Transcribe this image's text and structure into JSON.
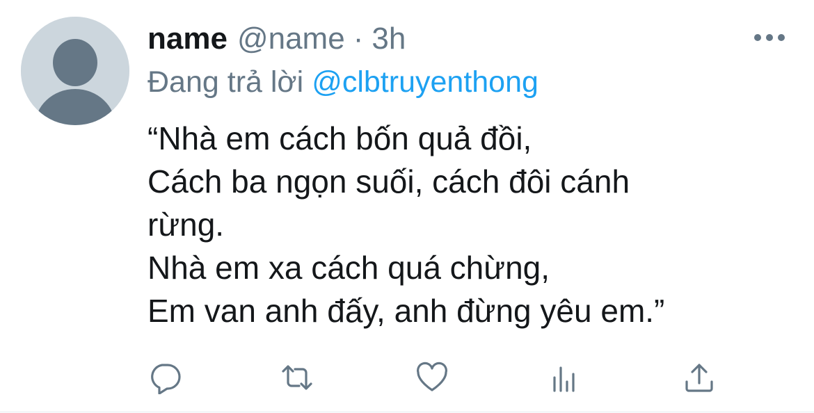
{
  "tweet": {
    "display_name": "name",
    "handle": "@name",
    "separator": "·",
    "time": "3h",
    "reply_prefix": "Đang trả lời",
    "reply_to": "@clbtruyenthong",
    "lines": [
      "“Nhà em cách bốn quả đồi,",
      "Cách ba ngọn suối, cách đôi cánh",
      "rừng.",
      "Nhà em xa cách quá chừng,",
      "Em van anh đấy, anh đừng yêu em.”"
    ]
  },
  "icons": {
    "avatar": "default-avatar-icon",
    "more": "more-options-icon",
    "reply": "reply-icon",
    "retweet": "retweet-icon",
    "like": "heart-icon",
    "analytics": "analytics-icon",
    "share": "share-icon"
  },
  "colors": {
    "text": "#14171a",
    "secondary": "#657786",
    "link": "#1da1f2",
    "avatar_bg": "#ccd6dd",
    "avatar_fg": "#657786"
  }
}
